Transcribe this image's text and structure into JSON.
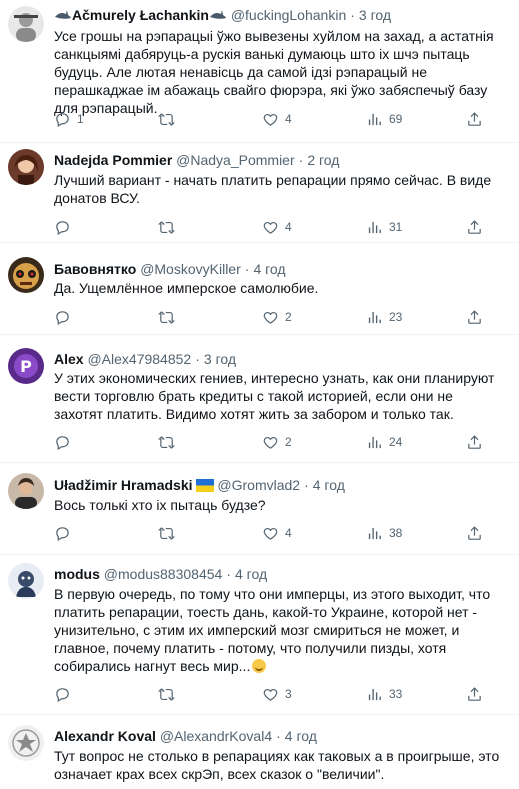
{
  "colors": {
    "text": "#0f1419",
    "muted": "#536471",
    "divider": "#eff3f4"
  },
  "tweets": [
    {
      "name": "Ačmurely Łachankin",
      "handle": "@fuckingLohankin",
      "time": "3 год",
      "text": "Усе грошы на рэпарацыі ўжо вывезены хуйлом на захад, а астатнія санкцыямі дабяруць-а рускія ванькі думаюць што іх шчэ пытаць будуць. Але лютая ненавісць да самой ідзі рэпарацый не перашкаджае ім абажаць свайго фюрэра, які ўжо забяспечыў базу для рэпарацый.",
      "reply": "1",
      "retweet": "",
      "like": "4",
      "views": "69"
    },
    {
      "name": "Nadejda Pommier",
      "handle": "@Nadya_Pommier",
      "time": "2 год",
      "text": "Лучший вариант - начать платить репарации прямо сейчас. В виде донатов ВСУ.",
      "reply": "",
      "retweet": "",
      "like": "4",
      "views": "31"
    },
    {
      "name": "Бавовнятко",
      "handle": "@MoskovyKiller",
      "time": "4 год",
      "text": "Да. Ущемлённое имперское самолюбие.",
      "reply": "",
      "retweet": "",
      "like": "2",
      "views": "23"
    },
    {
      "name": "Alex",
      "handle": "@Alex47984852",
      "time": "3 год",
      "text": "У этих экономических гениев, интересно узнать, как они планируют вести торговлю брать кредиты с такой историей, если они не захотят платить. Видимо хотят жить за забором и только так.",
      "reply": "",
      "retweet": "",
      "like": "2",
      "views": "24"
    },
    {
      "name": "Uładžimir Hramadski",
      "handle": "@Gromvlad2",
      "time": "4 год",
      "text": "Вось толькі хто іх пытаць будзе?",
      "reply": "",
      "retweet": "",
      "like": "4",
      "views": "38"
    },
    {
      "name": "modus",
      "handle": "@modus88308454",
      "time": "4 год",
      "text": "В первую очередь, по тому что они имперцы, из этого выходит, что платить репарации, тоесть дань, какой-то Украине, которой нет - унизительно, с этим их имперский мозг смириться не может, и главное, почему платить - потому, что получили пизды, хотя собирались нагнут весь мир...",
      "reply": "",
      "retweet": "",
      "like": "3",
      "views": "33"
    },
    {
      "name": "Alexandr Koval",
      "handle": "@AlexandrKoval4",
      "time": "4 год",
      "text": "Тут вопрос не столько в репарациях как таковых а в проигрыше, это означает крах всех скрЭп, всех сказок о \"величии\".",
      "reply": "",
      "retweet": "",
      "like": "",
      "views": ""
    }
  ]
}
